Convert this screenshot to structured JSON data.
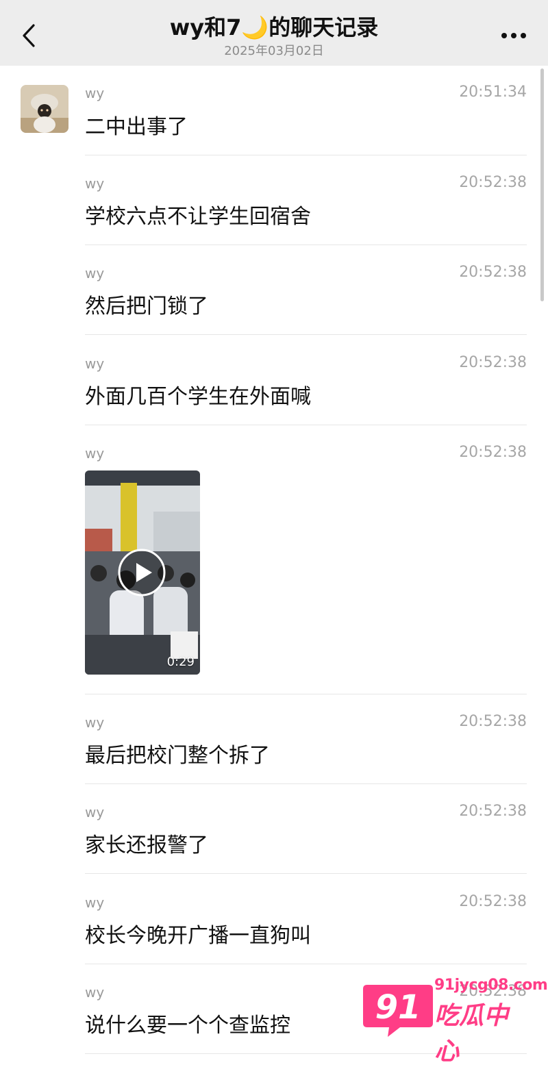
{
  "header": {
    "title": "wy和7🌙的聊天记录",
    "subtitle": "2025年03月02日",
    "back_icon": "chevron-left-icon",
    "more_icon": "more-horizontal-icon"
  },
  "messages": [
    {
      "sender": "wy",
      "time": "20:51:34",
      "text": "二中出事了",
      "type": "text"
    },
    {
      "sender": "wy",
      "time": "20:52:38",
      "text": "学校六点不让学生回宿舍",
      "type": "text"
    },
    {
      "sender": "wy",
      "time": "20:52:38",
      "text": "然后把门锁了",
      "type": "text"
    },
    {
      "sender": "wy",
      "time": "20:52:38",
      "text": "外面几百个学生在外面喊",
      "type": "text"
    },
    {
      "sender": "wy",
      "time": "20:52:38",
      "type": "video",
      "duration": "0:29"
    },
    {
      "sender": "wy",
      "time": "20:52:38",
      "text": "最后把校门整个拆了",
      "type": "text"
    },
    {
      "sender": "wy",
      "time": "20:52:38",
      "text": "家长还报警了",
      "type": "text"
    },
    {
      "sender": "wy",
      "time": "20:52:38",
      "text": "校长今晚开广播一直狗叫",
      "type": "text"
    },
    {
      "sender": "wy",
      "time": "20:52:38",
      "text": "说什么要一个个查监控",
      "type": "text"
    }
  ],
  "watermark": {
    "number": "91",
    "url": "91jycg08.com",
    "name": "吃瓜中心",
    "color": "#ff3d86"
  }
}
